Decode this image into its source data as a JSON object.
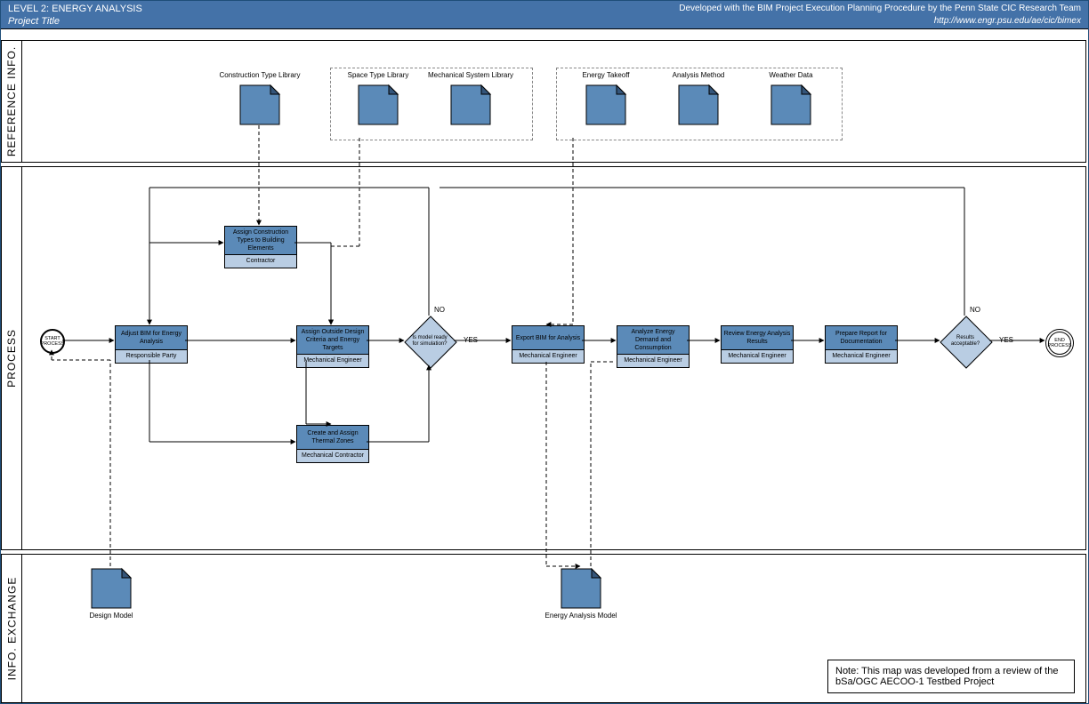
{
  "header": {
    "level": "LEVEL 2: ENERGY ANALYSIS",
    "project": "Project Title",
    "attribution": "Developed with the BIM Project Execution Planning Procedure by the Penn State CIC Research Team",
    "url": "http://www.engr.psu.edu/ae/cic/bimex"
  },
  "lanes": {
    "ref": "REFERENCE INFO.",
    "proc": "PROCESS",
    "exch": "INFO. EXCHANGE"
  },
  "ref_docs": {
    "d1": "Construction Type Library",
    "d2": "Space Type Library",
    "d3": "Mechanical System Library",
    "d4": "Energy Takeoff",
    "d5": "Analysis Method",
    "d6": "Weather Data"
  },
  "tasks": {
    "adjust": {
      "title": "Adjust BIM for Energy Analysis",
      "role": "Responsible Party"
    },
    "assignConstr": {
      "title": "Assign Construction Types to Building Elements",
      "role": "Contractor"
    },
    "assignCrit": {
      "title": "Assign Outside Design Criteria and Energy Targets",
      "role": "Mechanical Engineer"
    },
    "thermal": {
      "title": "Create and Assign Thermal Zones",
      "role": "Mechanical Contractor"
    },
    "export": {
      "title": "Export BIM for Analysis",
      "role": "Mechanical Engineer"
    },
    "analyze": {
      "title": "Analyze Energy Demand and Consumption",
      "role": "Mechanical Engineer"
    },
    "review": {
      "title": "Review Energy Analysis Results",
      "role": "Mechanical Engineer"
    },
    "report": {
      "title": "Prepare Report for Documentation",
      "role": "Mechanical Engineer"
    }
  },
  "gateways": {
    "g1": "Is model ready for simulation?",
    "g2": "Results acceptable?"
  },
  "events": {
    "start": "START PROCESS",
    "end": "END PROCESS"
  },
  "labels": {
    "yes": "YES",
    "no": "NO"
  },
  "exch_docs": {
    "dm": "Design Model",
    "eam": "Energy Analysis Model"
  },
  "note": "Note: This map was developed from a review of the bSa/OGC AECOO-1 Testbed Project"
}
